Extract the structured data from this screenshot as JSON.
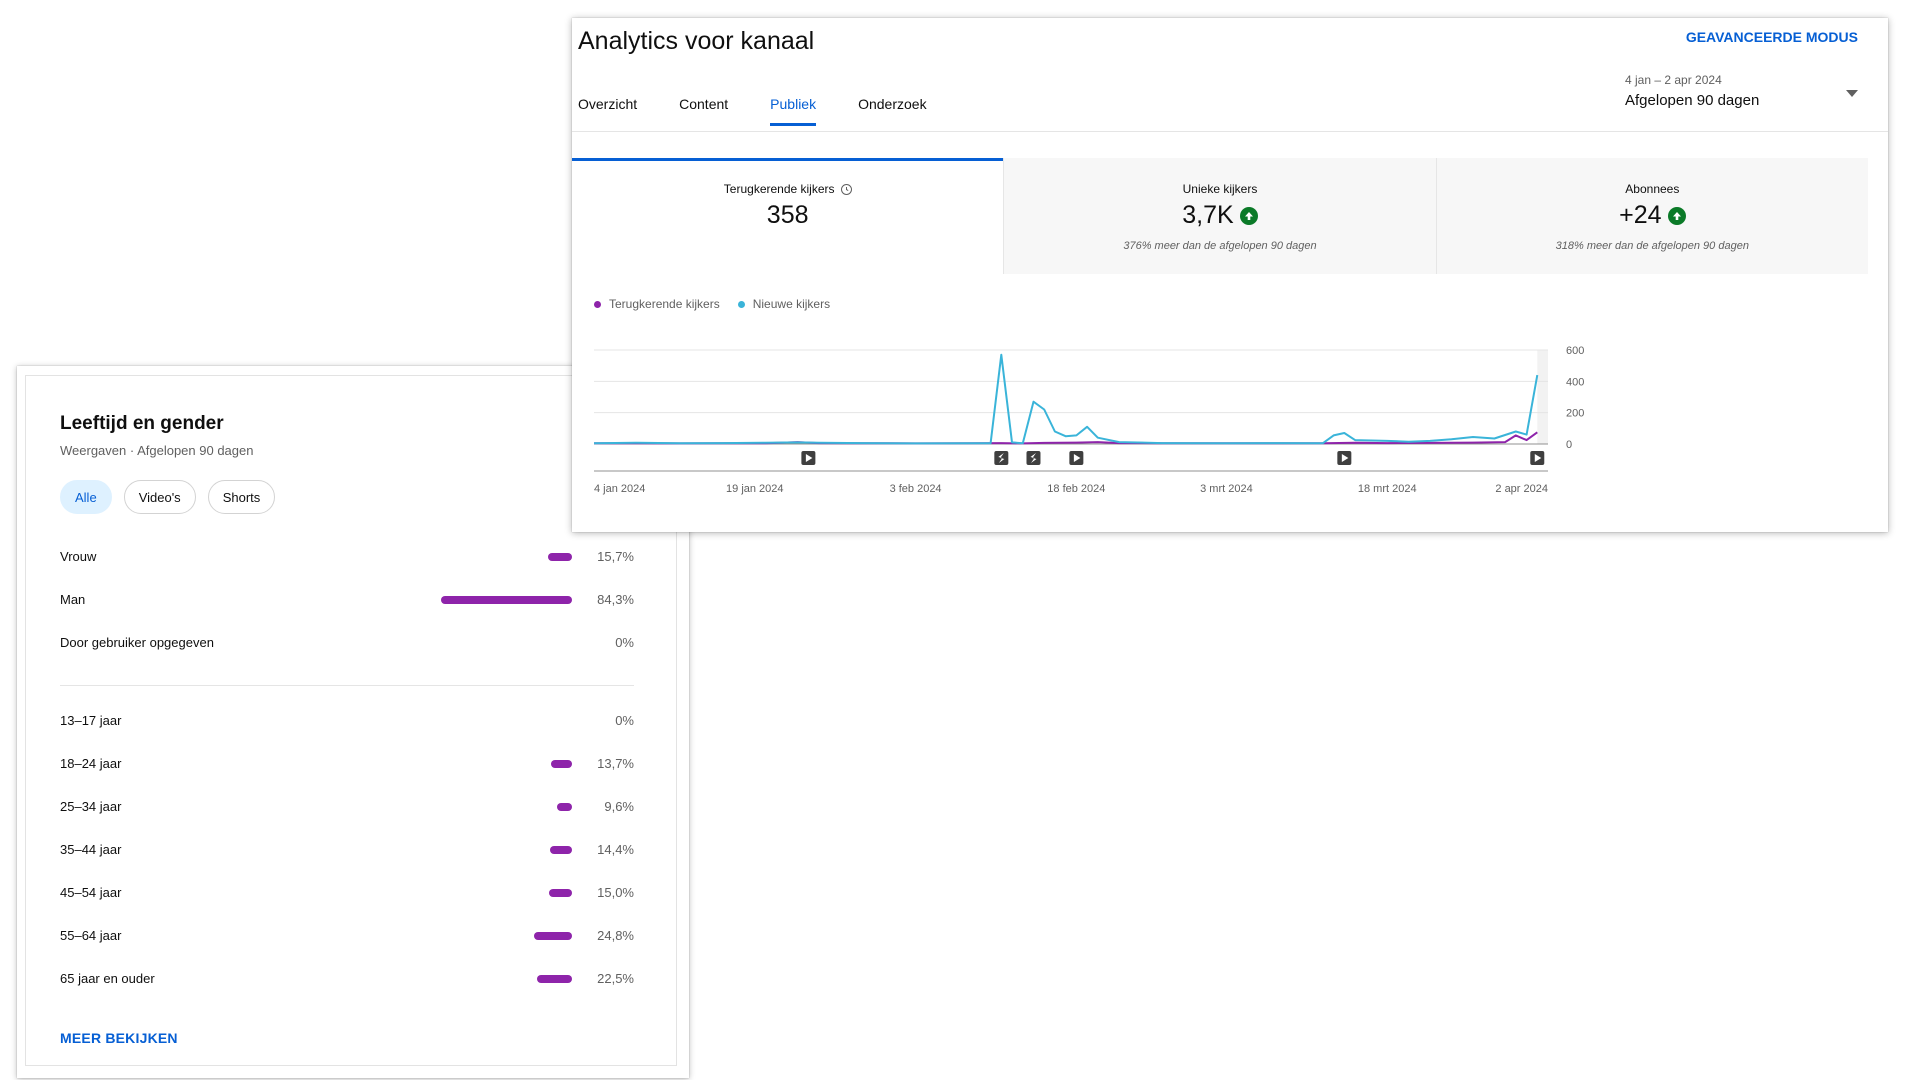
{
  "age_gender": {
    "title": "Leeftijd en gender",
    "subtitle": "Weergaven · Afgelopen 90 dagen",
    "filters": [
      "Alle",
      "Video's",
      "Shorts"
    ],
    "active_filter": "Alle",
    "gender": [
      {
        "label": "Vrouw",
        "value": "15,7%",
        "fraction": 0.157
      },
      {
        "label": "Man",
        "value": "84,3%",
        "fraction": 0.843
      },
      {
        "label": "Door gebruiker opgegeven",
        "value": "0%",
        "fraction": 0
      }
    ],
    "age": [
      {
        "label": "13–17 jaar",
        "value": "0%",
        "fraction": 0
      },
      {
        "label": "18–24 jaar",
        "value": "13,7%",
        "fraction": 0.137
      },
      {
        "label": "25–34 jaar",
        "value": "9,6%",
        "fraction": 0.096
      },
      {
        "label": "35–44 jaar",
        "value": "14,4%",
        "fraction": 0.144
      },
      {
        "label": "45–54 jaar",
        "value": "15,0%",
        "fraction": 0.15
      },
      {
        "label": "55–64 jaar",
        "value": "24,8%",
        "fraction": 0.248
      },
      {
        "label": "65 jaar en ouder",
        "value": "22,5%",
        "fraction": 0.225
      }
    ],
    "more_link": "MEER BEKIJKEN",
    "bar_color": "#8e24aa"
  },
  "analytics": {
    "title": "Analytics voor kanaal",
    "advanced_mode": "GEAVANCEERDE MODUS",
    "tabs": [
      "Overzicht",
      "Content",
      "Publiek",
      "Onderzoek"
    ],
    "active_tab": "Publiek",
    "date_range": "4 jan – 2 apr 2024",
    "date_label": "Afgelopen 90 dagen",
    "metrics": [
      {
        "label": "Terugkerende kijkers",
        "value": "358",
        "note": ""
      },
      {
        "label": "Unieke kijkers",
        "value": "3,7K",
        "note": "376% meer dan de afgelopen 90 dagen"
      },
      {
        "label": "Abonnees",
        "value": "+24",
        "note": "318% meer dan de afgelopen 90 dagen"
      }
    ],
    "accent_color": "#065fd4",
    "up_color": "#0b7a28"
  },
  "chart_data": {
    "type": "line",
    "x_start": "2024-01-04",
    "x_end": "2024-04-02",
    "x_ticks": [
      {
        "date": "2024-01-04",
        "label": "4 jan 2024"
      },
      {
        "date": "2024-01-19",
        "label": "19 jan 2024"
      },
      {
        "date": "2024-02-03",
        "label": "3 feb 2024"
      },
      {
        "date": "2024-02-18",
        "label": "18 feb 2024"
      },
      {
        "date": "2024-03-03",
        "label": "3 mrt 2024"
      },
      {
        "date": "2024-03-18",
        "label": "18 mrt 2024"
      },
      {
        "date": "2024-04-02",
        "label": "2 apr 2024"
      }
    ],
    "y_ticks": [
      0,
      200,
      400,
      600
    ],
    "ylim": [
      0,
      600
    ],
    "grid": true,
    "legend_position": "top-left",
    "series": [
      {
        "name": "Terugkerende kijkers",
        "color": "#8e24aa",
        "points": [
          [
            "2024-01-04",
            5
          ],
          [
            "2024-01-08",
            5
          ],
          [
            "2024-01-12",
            4
          ],
          [
            "2024-01-16",
            5
          ],
          [
            "2024-01-20",
            5
          ],
          [
            "2024-01-23",
            12
          ],
          [
            "2024-01-25",
            6
          ],
          [
            "2024-01-29",
            5
          ],
          [
            "2024-02-03",
            4
          ],
          [
            "2024-02-08",
            5
          ],
          [
            "2024-02-11",
            6
          ],
          [
            "2024-02-13",
            4
          ],
          [
            "2024-02-15",
            7
          ],
          [
            "2024-02-18",
            9
          ],
          [
            "2024-02-20",
            12
          ],
          [
            "2024-02-22",
            6
          ],
          [
            "2024-02-26",
            5
          ],
          [
            "2024-03-03",
            5
          ],
          [
            "2024-03-08",
            5
          ],
          [
            "2024-03-12",
            5
          ],
          [
            "2024-03-15",
            8
          ],
          [
            "2024-03-18",
            6
          ],
          [
            "2024-03-22",
            7
          ],
          [
            "2024-03-26",
            9
          ],
          [
            "2024-03-29",
            12
          ],
          [
            "2024-03-30",
            55
          ],
          [
            "2024-03-31",
            25
          ],
          [
            "2024-04-01",
            75
          ]
        ]
      },
      {
        "name": "Nieuwe kijkers",
        "color": "#3ab4d9",
        "points": [
          [
            "2024-01-04",
            5
          ],
          [
            "2024-01-08",
            8
          ],
          [
            "2024-01-12",
            5
          ],
          [
            "2024-01-16",
            6
          ],
          [
            "2024-01-20",
            8
          ],
          [
            "2024-01-23",
            10
          ],
          [
            "2024-01-25",
            8
          ],
          [
            "2024-01-29",
            6
          ],
          [
            "2024-02-03",
            4
          ],
          [
            "2024-02-08",
            5
          ],
          [
            "2024-02-10",
            5
          ],
          [
            "2024-02-11",
            570
          ],
          [
            "2024-02-12",
            10
          ],
          [
            "2024-02-13",
            5
          ],
          [
            "2024-02-14",
            270
          ],
          [
            "2024-02-15",
            220
          ],
          [
            "2024-02-16",
            80
          ],
          [
            "2024-02-17",
            50
          ],
          [
            "2024-02-18",
            55
          ],
          [
            "2024-02-19",
            110
          ],
          [
            "2024-02-20",
            40
          ],
          [
            "2024-02-22",
            12
          ],
          [
            "2024-02-26",
            6
          ],
          [
            "2024-03-03",
            5
          ],
          [
            "2024-03-08",
            6
          ],
          [
            "2024-03-12",
            5
          ],
          [
            "2024-03-13",
            55
          ],
          [
            "2024-03-14",
            70
          ],
          [
            "2024-03-15",
            25
          ],
          [
            "2024-03-18",
            20
          ],
          [
            "2024-03-20",
            15
          ],
          [
            "2024-03-22",
            20
          ],
          [
            "2024-03-24",
            30
          ],
          [
            "2024-03-26",
            45
          ],
          [
            "2024-03-28",
            35
          ],
          [
            "2024-03-30",
            80
          ],
          [
            "2024-03-31",
            60
          ],
          [
            "2024-04-01",
            440
          ]
        ]
      }
    ],
    "upload_markers": [
      {
        "date": "2024-01-24",
        "kind": "video"
      },
      {
        "date": "2024-02-11",
        "kind": "short"
      },
      {
        "date": "2024-02-14",
        "kind": "short"
      },
      {
        "date": "2024-02-18",
        "kind": "video"
      },
      {
        "date": "2024-03-14",
        "kind": "video"
      },
      {
        "date": "2024-04-01",
        "kind": "video"
      }
    ]
  }
}
